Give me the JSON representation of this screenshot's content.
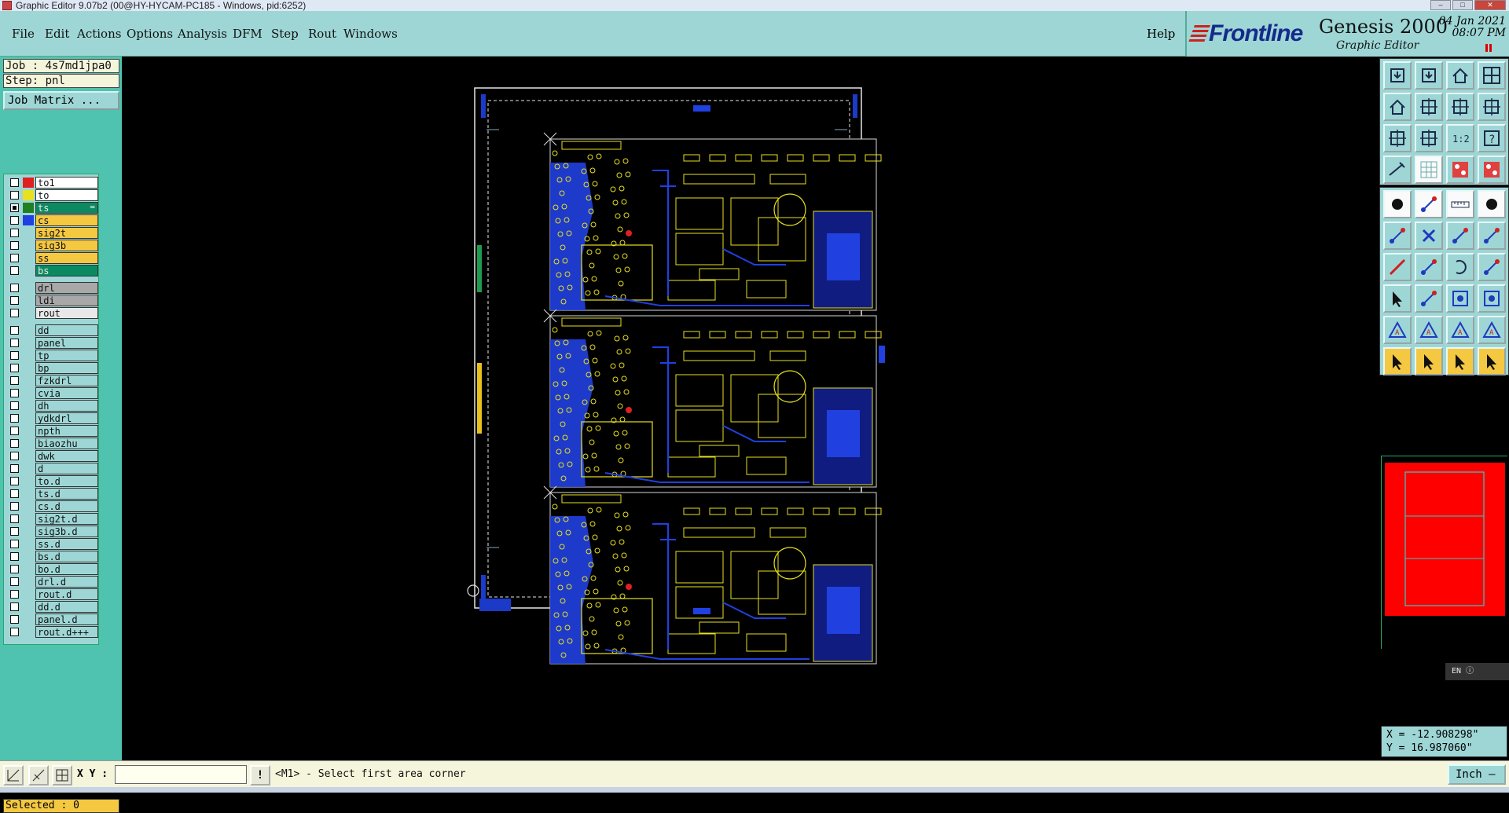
{
  "window": {
    "title": "Graphic Editor 9.07b2 (00@HY-HYCAM-PC185 - Windows, pid:6252)"
  },
  "menu": {
    "items": [
      "File",
      "Edit",
      "Actions",
      "Options",
      "Analysis",
      "DFM",
      "Step",
      "Rout",
      "Windows"
    ],
    "help": "Help"
  },
  "brand": {
    "logo": "Frontline",
    "product": "Genesis 2000",
    "subtitle": "Graphic Editor",
    "date": "04 Jan 2021",
    "time": "08:07 PM"
  },
  "job": {
    "job_label": "Job : 4s7md1jpa0",
    "step_label": "Step: pnl",
    "matrix_button": "Job Matrix ..."
  },
  "layers": [
    {
      "name": "to1",
      "color": "#e02020",
      "bg": "#ffffff",
      "checked": false
    },
    {
      "name": "to",
      "color": "#e8e020",
      "bg": "#ffffff",
      "checked": false
    },
    {
      "name": "ts",
      "color": "#208020",
      "bg": "#0b8a62",
      "checked": true,
      "marker": "="
    },
    {
      "name": "cs",
      "color": "#2040e0",
      "bg": "#f5c842",
      "checked": false
    },
    {
      "name": "sig2t",
      "color": "#9ed6d6",
      "bg": "#f5c842",
      "checked": false
    },
    {
      "name": "sig3b",
      "color": "#9ed6d6",
      "bg": "#f5c842",
      "checked": false
    },
    {
      "name": "ss",
      "color": "#9ed6d6",
      "bg": "#f5c842",
      "checked": false
    },
    {
      "name": "bs",
      "color": "#9ed6d6",
      "bg": "#0b8a62",
      "checked": false
    },
    {
      "name": "drl",
      "color": "#9ed6d6",
      "bg": "#a8a8a8",
      "checked": false
    },
    {
      "name": "ldi",
      "color": "#9ed6d6",
      "bg": "#a8a8a8",
      "checked": false
    },
    {
      "name": "rout",
      "color": "#9ed6d6",
      "bg": "#e8e8e8",
      "checked": false
    },
    {
      "name": "dd",
      "color": "#9ed6d6",
      "bg": "#9ed6d6",
      "checked": false
    },
    {
      "name": "panel",
      "color": "#9ed6d6",
      "bg": "#9ed6d6",
      "checked": false
    },
    {
      "name": "tp",
      "color": "#9ed6d6",
      "bg": "#9ed6d6",
      "checked": false
    },
    {
      "name": "bp",
      "color": "#9ed6d6",
      "bg": "#9ed6d6",
      "checked": false
    },
    {
      "name": "fzkdrl",
      "color": "#9ed6d6",
      "bg": "#9ed6d6",
      "checked": false
    },
    {
      "name": "cvia",
      "color": "#9ed6d6",
      "bg": "#9ed6d6",
      "checked": false
    },
    {
      "name": "dh",
      "color": "#9ed6d6",
      "bg": "#9ed6d6",
      "checked": false
    },
    {
      "name": "ydkdrl",
      "color": "#9ed6d6",
      "bg": "#9ed6d6",
      "checked": false
    },
    {
      "name": "npth",
      "color": "#9ed6d6",
      "bg": "#9ed6d6",
      "checked": false
    },
    {
      "name": "biaozhu",
      "color": "#9ed6d6",
      "bg": "#9ed6d6",
      "checked": false
    },
    {
      "name": "dwk",
      "color": "#9ed6d6",
      "bg": "#9ed6d6",
      "checked": false
    },
    {
      "name": "d",
      "color": "#9ed6d6",
      "bg": "#9ed6d6",
      "checked": false
    },
    {
      "name": "to.d",
      "color": "#9ed6d6",
      "bg": "#9ed6d6",
      "checked": false
    },
    {
      "name": "ts.d",
      "color": "#9ed6d6",
      "bg": "#9ed6d6",
      "checked": false
    },
    {
      "name": "cs.d",
      "color": "#9ed6d6",
      "bg": "#9ed6d6",
      "checked": false
    },
    {
      "name": "sig2t.d",
      "color": "#9ed6d6",
      "bg": "#9ed6d6",
      "checked": false
    },
    {
      "name": "sig3b.d",
      "color": "#9ed6d6",
      "bg": "#9ed6d6",
      "checked": false
    },
    {
      "name": "ss.d",
      "color": "#9ed6d6",
      "bg": "#9ed6d6",
      "checked": false
    },
    {
      "name": "bs.d",
      "color": "#9ed6d6",
      "bg": "#9ed6d6",
      "checked": false
    },
    {
      "name": "bo.d",
      "color": "#9ed6d6",
      "bg": "#9ed6d6",
      "checked": false
    },
    {
      "name": "drl.d",
      "color": "#9ed6d6",
      "bg": "#9ed6d6",
      "checked": false
    },
    {
      "name": "rout.d",
      "color": "#9ed6d6",
      "bg": "#9ed6d6",
      "checked": false
    },
    {
      "name": "dd.d",
      "color": "#9ed6d6",
      "bg": "#9ed6d6",
      "checked": false
    },
    {
      "name": "panel.d",
      "color": "#9ed6d6",
      "bg": "#9ed6d6",
      "checked": false
    },
    {
      "name": "rout.d+++",
      "color": "#9ed6d6",
      "bg": "#9ed6d6",
      "checked": false
    }
  ],
  "status": {
    "selected": "Selected : 0",
    "xy_label": "X Y :",
    "xy_value": "",
    "prompt": "<M1> - Select first area corner",
    "units": "Inch",
    "cursor_x": "X = -12.908298\"",
    "cursor_y": "Y = 16.987060\""
  },
  "language": {
    "indicator": "EN"
  },
  "colors": {
    "panel_bg": "#9ed6d6",
    "trace_yellow": "#e8e020",
    "copper_blue": "#2040e0",
    "minimap_red": "#ff0000"
  },
  "icons": {
    "tools_group1": [
      "open-step-icon",
      "save-icon",
      "home-icon",
      "window-split-icon",
      "zoom-home-icon",
      "zoom-out-page-icon",
      "zoom-back-icon",
      "pan-icon",
      "zoom-fit-icon",
      "zoom-in-icon",
      "ratio-1-2-icon",
      "help-query-icon",
      "measure-icon",
      "grid-icon",
      "snap-red-icon",
      "snap-red-2-icon"
    ],
    "tools_group2": [
      "add-pad-icon",
      "add-line-icon",
      "ruler-icon",
      "pad-circle-icon",
      "connect-icon",
      "delete-x-icon",
      "line-node-icon",
      "line-node-2-icon",
      "draw-red-line-icon",
      "draw-line-icon",
      "arc-icon",
      "polyline-icon",
      "pad-select-icon",
      "line-dash-icon",
      "feature-box-icon",
      "feature-group-icon",
      "triangle-icon",
      "triangle-a-icon",
      "triangle-b-icon",
      "triangle-c-icon",
      "select-icon",
      "select-box-icon",
      "select-lasso-icon",
      "select-net-icon"
    ]
  }
}
